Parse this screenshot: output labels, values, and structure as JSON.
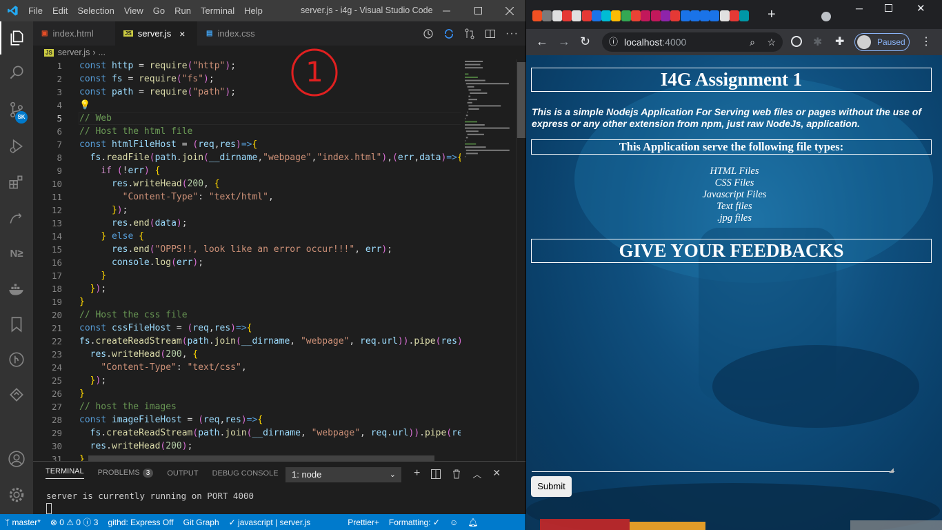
{
  "vscode": {
    "menus": [
      "File",
      "Edit",
      "Selection",
      "View",
      "Go",
      "Run",
      "Terminal",
      "Help"
    ],
    "window_title": "server.js - i4g - Visual Studio Code",
    "tabs": [
      {
        "label": "index.html",
        "icon": "html5-icon",
        "active": false
      },
      {
        "label": "server.js",
        "icon": "js-file-icon",
        "active": true
      },
      {
        "label": "index.css",
        "icon": "css-file-icon",
        "active": false
      }
    ],
    "breadcrumb": {
      "file": "server.js",
      "more": "..."
    },
    "line_numbers": [
      "1",
      "2",
      "3",
      "4",
      "5",
      "6",
      "7",
      "8",
      "9",
      "10",
      "11",
      "12",
      "13",
      "14",
      "15",
      "16",
      "17",
      "18",
      "19",
      "20",
      "21",
      "22",
      "23",
      "24",
      "25",
      "26",
      "27",
      "28",
      "29",
      "30",
      "31"
    ],
    "current_line": 5,
    "code_lines": [
      "const http = require(\"http\");",
      "const fs = require(\"fs\");",
      "const path = require(\"path\");",
      "",
      "// Web",
      "// Host the html file",
      "const htmlFileHost = (req,res)=>{",
      "  fs.readFile(path.join(__dirname,\"webpage\",\"index.html\"),(err,data)=>{",
      "    if (!err) {",
      "      res.writeHead(200, {",
      "        \"Content-Type\": \"text/html\",",
      "      });",
      "      res.end(data);",
      "    } else {",
      "      res.end(\"OPPS!!, look like an error occur!!!\", err);",
      "      console.log(err);",
      "    }",
      "  });",
      "}",
      "// Host the css file",
      "const cssFileHost = (req,res)=>{",
      "fs.createReadStream(path.join(__dirname, \"webpage\", req.url)).pipe(res);",
      "  res.writeHead(200, {",
      "    \"Content-Type\": \"text/css\",",
      "  });",
      "}",
      "// host the images",
      "const imageFileHost = (req,res)=>{",
      "  fs.createReadStream(path.join(__dirname, \"webpage\", req.url)).pipe(res",
      "  res.writeHead(200);",
      "}"
    ],
    "annotation": "1",
    "panel": {
      "tabs": [
        {
          "label": "TERMINAL",
          "active": true
        },
        {
          "label": "PROBLEMS",
          "badge": "3"
        },
        {
          "label": "OUTPUT"
        },
        {
          "label": "DEBUG CONSOLE"
        }
      ],
      "terminal_select": "1: node",
      "terminal_output": "server is currently running on PORT 4000"
    },
    "status": {
      "branch": "master*",
      "errors": "0",
      "warnings": "0",
      "info": "3",
      "githd": "githd: Express Off",
      "git_graph": "Git Graph",
      "language": "javascript | server.js",
      "prettier": "Prettier+",
      "formatting": "Formatting: ✓"
    },
    "activity_icons": [
      "explorer-icon",
      "search-icon",
      "source-control-icon",
      "run-debug-icon",
      "extensions-icon",
      "live-share-icon",
      "n2-icon",
      "docker-icon",
      "bookmarks-icon",
      "git-graph-icon",
      "azure-icon",
      "account-icon",
      "manage-gear-icon"
    ]
  },
  "chrome": {
    "url_host": "localhost",
    "url_port": ":4000",
    "profile_label": "Paused",
    "page": {
      "title": "I4G Assignment 1",
      "description": "This is a simple Nodejs Application For Serving web files or pages without the use of express or any other extension from npm, just raw NodeJs, application.",
      "subheading": "This Application serve the following file types:",
      "file_types": [
        "HTML Files",
        "CSS Files",
        "Javascript Files",
        "Text files",
        ".jpg files"
      ],
      "feedback_heading": "GIVE YOUR FEEDBACKS",
      "submit_label": "Submit"
    },
    "tab_favicon_colors": [
      "#f25022",
      "#7a7a7a",
      "#e0e0e0",
      "#e53935",
      "#e0e0e0",
      "#e53935",
      "#1a73e8",
      "#00bcd4",
      "#fbbc05",
      "#34a853",
      "#ea4335",
      "#c2185b",
      "#c2185b",
      "#8e24aa",
      "#e53935",
      "#1a73e8",
      "#1a73e8",
      "#1a73e8",
      "#1a73e8",
      "#e0e0e0",
      "#e53935",
      "#0097a7"
    ]
  },
  "colors": {
    "vscode_status": "#007acc",
    "editor_bg": "#1e1e1e",
    "annotation_red": "#e02020"
  }
}
